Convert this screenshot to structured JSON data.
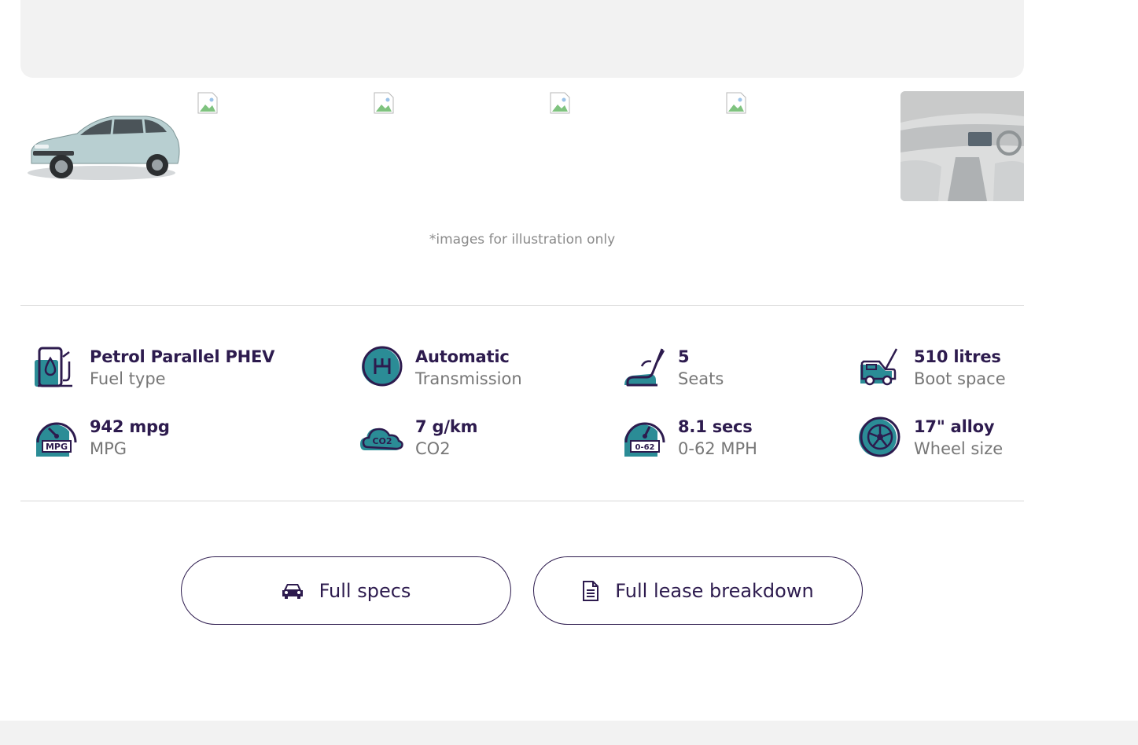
{
  "gallery": {
    "note": "*images for illustration only"
  },
  "specs": [
    {
      "value": "Petrol Parallel PHEV",
      "label": "Fuel type",
      "icon": "fuel-pump-icon"
    },
    {
      "value": "Automatic",
      "label": "Transmission",
      "icon": "gearbox-icon"
    },
    {
      "value": "5",
      "label": "Seats",
      "icon": "seat-icon"
    },
    {
      "value": "510 litres",
      "label": "Boot space",
      "icon": "car-boot-icon"
    },
    {
      "value": "942 mpg",
      "label": "MPG",
      "icon": "mpg-gauge-icon"
    },
    {
      "value": "7 g/km",
      "label": "CO2",
      "icon": "co2-cloud-icon"
    },
    {
      "value": "8.1 secs",
      "label": "0-62 MPH",
      "icon": "acceleration-gauge-icon"
    },
    {
      "value": "17\" alloy",
      "label": "Wheel size",
      "icon": "alloy-wheel-icon"
    }
  ],
  "icon_text": {
    "mpg": "MPG",
    "co2": "CO2",
    "accel": "0-62"
  },
  "buttons": {
    "full_specs": "Full specs",
    "full_lease": "Full lease breakdown"
  },
  "colors": {
    "accent": "#2b8c96",
    "text_dark": "#2d1b4e",
    "text_muted": "#777777",
    "panel_bg": "#f2f2f2"
  }
}
